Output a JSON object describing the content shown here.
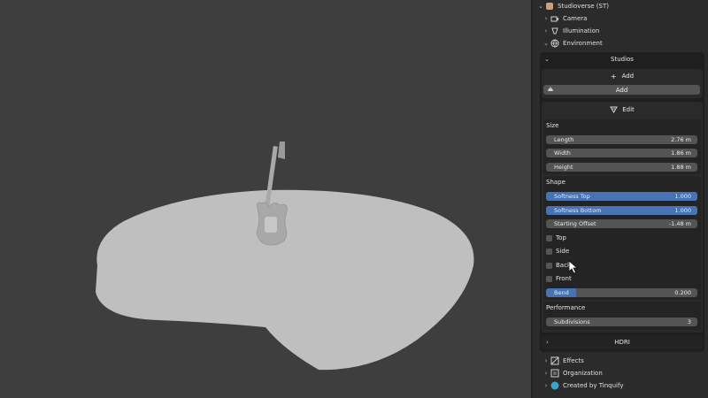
{
  "tree": {
    "root_label": "Studioverse (ST)",
    "items": [
      {
        "label": "Camera",
        "icon": "camera-icon"
      },
      {
        "label": "Illumination",
        "icon": "light-icon"
      },
      {
        "label": "Environment",
        "icon": "world-icon"
      }
    ],
    "bottom_items": [
      {
        "label": "Effects",
        "icon": "effects-icon"
      },
      {
        "label": "Organization",
        "icon": "organization-icon"
      },
      {
        "label": "Created by Tinquify",
        "icon": "tinquify-icon"
      }
    ]
  },
  "studios": {
    "title": "Studios",
    "add_label": "Add",
    "add_button_label": "Add",
    "edit_label": "Edit",
    "size": {
      "title": "Size",
      "fields": [
        {
          "label": "Length",
          "value": "2.76 m"
        },
        {
          "label": "Width",
          "value": "1.86 m"
        },
        {
          "label": "Height",
          "value": "1.88 m"
        }
      ]
    },
    "shape": {
      "title": "Shape",
      "softness_top": {
        "label": "Softness Top",
        "value": "1.000",
        "fill": 1.0
      },
      "softness_bottom": {
        "label": "Softness Bottom",
        "value": "1.000",
        "fill": 1.0
      },
      "starting_offset": {
        "label": "Starting Offset",
        "value": "-1.48 m"
      },
      "checkboxes": [
        {
          "label": "Top",
          "checked": false
        },
        {
          "label": "Side",
          "checked": false
        },
        {
          "label": "Back",
          "checked": false
        },
        {
          "label": "Front",
          "checked": false
        }
      ],
      "bend": {
        "label": "Bend",
        "value": "0.200",
        "fill": 0.2
      }
    },
    "performance": {
      "title": "Performance",
      "subdivisions": {
        "label": "Subdivisions",
        "value": "3"
      }
    }
  },
  "hdri": {
    "title": "HDRI"
  },
  "colors": {
    "accent_blue": "#4772b3",
    "field_gray": "#545454",
    "panel_dark": "#1f1f1f",
    "viewport_bg": "#3e3e3e",
    "floor": "#bdbdbd"
  }
}
